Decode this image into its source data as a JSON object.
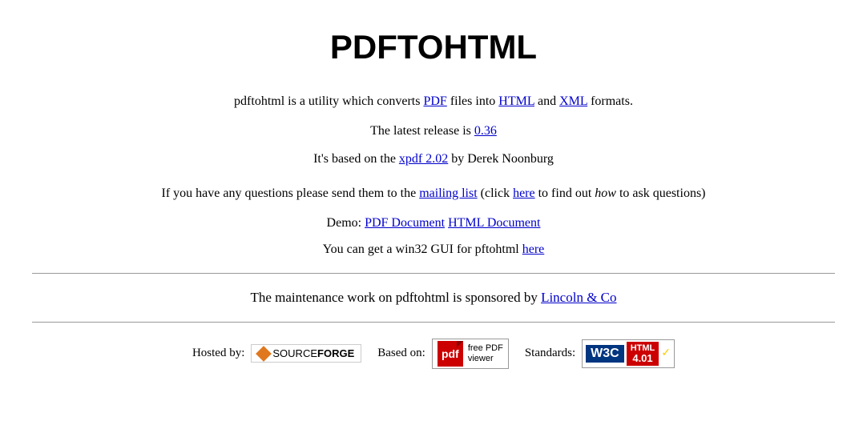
{
  "page": {
    "title": "PDFTOHTML"
  },
  "intro": {
    "text_before_pdf": "pdftohtml is a utility which converts ",
    "pdf_link_text": "PDF",
    "pdf_link_href": "#",
    "text_between_1": " files into ",
    "html_link_text": "HTML",
    "html_link_href": "#",
    "text_between_2": " and ",
    "xml_link_text": "XML",
    "xml_link_href": "#",
    "text_after": " formats."
  },
  "release": {
    "text_before": "The latest release is ",
    "version_link_text": "0.36",
    "version_link_href": "#",
    "xpdf_line_before": "It's based on the ",
    "xpdf_link_text": "xpdf 2.02",
    "xpdf_link_href": "#",
    "xpdf_line_after": " by Derek Noonburg"
  },
  "questions": {
    "text_before": "If you have any questions please send them to the ",
    "mailing_link_text": "mailing list",
    "mailing_link_href": "#",
    "text_middle": " (click ",
    "here_link_text": "here",
    "here_link_href": "#",
    "text_after": " to find out ",
    "how_text": "how",
    "text_end": " to ask questions)"
  },
  "demo": {
    "label": "Demo: ",
    "pdf_doc_link": "PDF Document",
    "pdf_doc_href": "#",
    "html_doc_link": "HTML Document",
    "html_doc_href": "#"
  },
  "win32": {
    "text_before": "You can get a win32 GUI for pftohtml ",
    "here_link": "here",
    "here_href": "#"
  },
  "sponsor": {
    "text_before": "The maintenance work on pdftohtml is sponsored by ",
    "link_text": "Lincoln & Co",
    "link_href": "#"
  },
  "footer": {
    "hosted_label": "Hosted by:",
    "sf_name": "SOURCEFORGE",
    "based_label": "Based on:",
    "pdf_badge_line1": "free PDF",
    "pdf_badge_line2": "viewer",
    "pdf_icon_text": "pdf",
    "standards_label": "Standards:",
    "w3c_left": "W3C",
    "w3c_html": "HTML",
    "w3c_version": "4.01"
  }
}
